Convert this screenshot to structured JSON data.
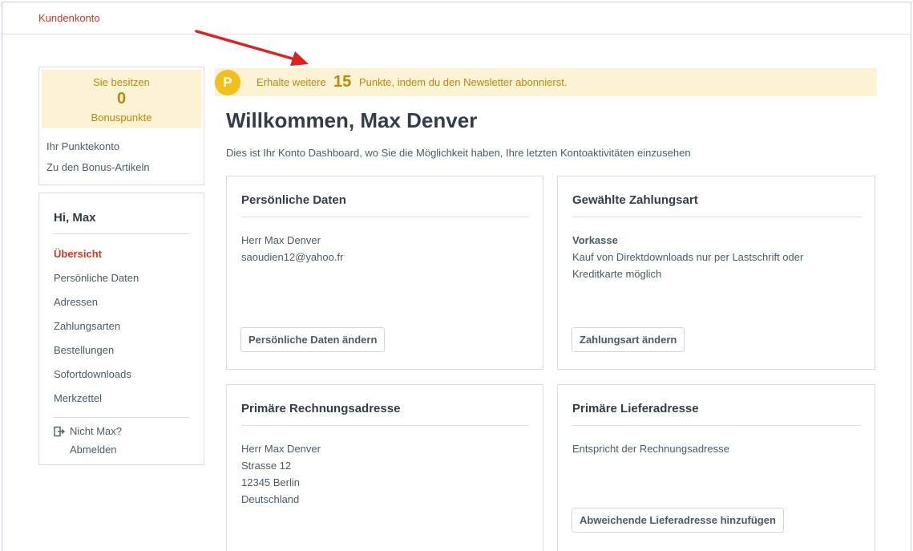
{
  "breadcrumb": "Kundenkonto",
  "bonus": {
    "line1": "Sie besitzen",
    "points": "0",
    "line2": "Bonuspunkte",
    "links": [
      "Ihr Punktekonto",
      "Zu den Bonus-Artikeln"
    ]
  },
  "nav": {
    "greeting": "Hi, Max",
    "items": [
      "Übersicht",
      "Persönliche Daten",
      "Adressen",
      "Zahlungsarten",
      "Bestellungen",
      "Sofortdownloads",
      "Merkzettel"
    ],
    "active_index": 0,
    "not_user": "Nicht Max?",
    "logout": "Abmelden"
  },
  "banner": {
    "badge": "P",
    "prefix": "Erhalte weitere",
    "points": "15",
    "suffix": "Punkte, indem du den Newsletter abonnierst."
  },
  "main": {
    "title": "Willkommen, Max Denver",
    "description": "Dies ist Ihr Konto Dashboard, wo Sie die Möglichkeit haben, Ihre letzten Kontoaktivitäten einzusehen"
  },
  "cards": {
    "personal": {
      "title": "Persönliche Daten",
      "lines": [
        "Herr Max Denver",
        "saoudien12@yahoo.fr"
      ],
      "button": "Persönliche Daten ändern"
    },
    "payment": {
      "title": "Gewählte Zahlungsart",
      "method": "Vorkasse",
      "lines": [
        "Kauf von Direktdownloads nur per Lastschrift oder",
        "Kreditkarte möglich"
      ],
      "button": "Zahlungsart ändern"
    },
    "billing": {
      "title": "Primäre Rechnungsadresse",
      "lines": [
        "Herr Max Denver",
        "Strasse 12",
        "12345 Berlin",
        "Deutschland"
      ]
    },
    "shipping": {
      "title": "Primäre Lieferadresse",
      "lines": [
        "Entspricht der Rechnungsadresse"
      ],
      "button": "Abweichende Lieferadresse hinzufügen"
    }
  },
  "colors": {
    "accent": "#d9341c",
    "bonus_bg": "#fbf3d3",
    "bonus_text": "#b8890a",
    "badge": "#f3c01b",
    "arrow": "#e02020"
  }
}
